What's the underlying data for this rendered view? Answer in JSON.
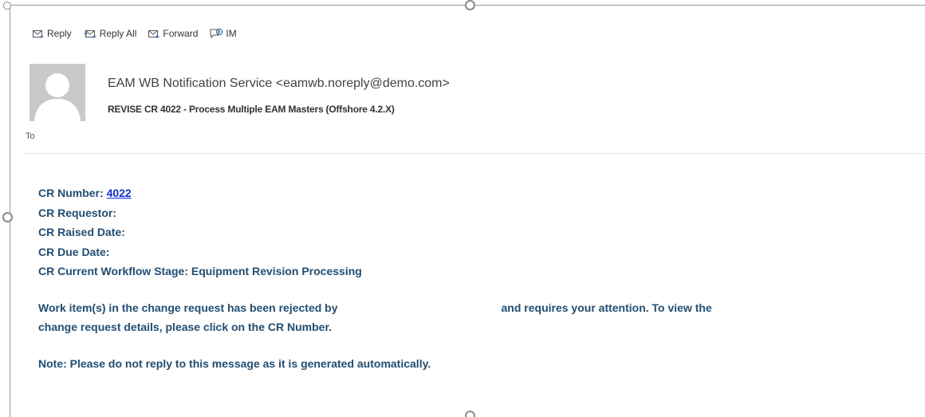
{
  "toolbar": {
    "reply_label": "Reply",
    "reply_all_label": "Reply All",
    "forward_label": "Forward",
    "im_label": "IM"
  },
  "header": {
    "sender": "EAM WB Notification Service <eamwb.noreply@demo.com>",
    "subject": "REVISE CR 4022 - Process Multiple EAM Masters (Offshore 4.2.X)",
    "to_label": "To"
  },
  "body": {
    "cr_number_label": "CR Number: ",
    "cr_number_value": "4022",
    "cr_requestor_label": "CR Requestor:",
    "cr_raised_date_label": "CR Raised Date:",
    "cr_due_date_label": "CR Due Date:",
    "cr_stage_label": "CR Current Workflow Stage: ",
    "cr_stage_value": "Equipment Revision Processing",
    "rejection_part1": "Work item(s) in the change request has been rejected by",
    "rejection_part2": "and requires your attention. To view the",
    "rejection_line2": "change request details, please click on the CR Number.",
    "note": "Note: Please do not reply to this message as it is generated automatically."
  },
  "colors": {
    "body_text": "#1f4e79",
    "link": "#0b2ee0",
    "avatar_bg": "#c9c9c9",
    "icon_blue": "#3b6fb6"
  }
}
